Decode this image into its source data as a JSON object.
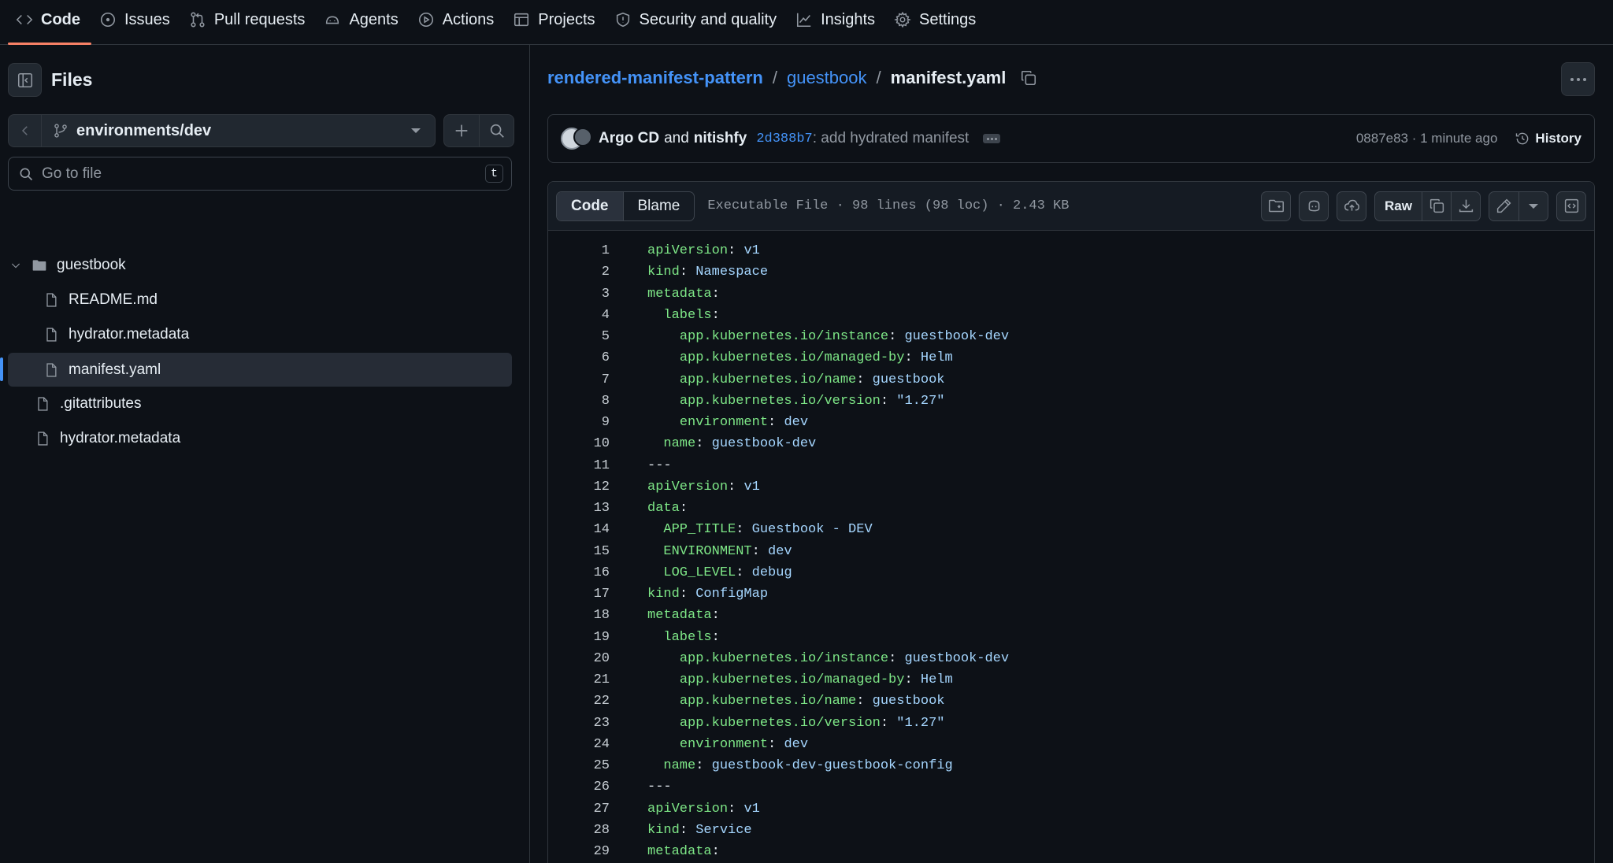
{
  "nav": {
    "tabs": [
      {
        "label": "Code",
        "icon": "code-icon"
      },
      {
        "label": "Issues",
        "icon": "issue-icon"
      },
      {
        "label": "Pull requests",
        "icon": "pull-request-icon"
      },
      {
        "label": "Agents",
        "icon": "agent-icon"
      },
      {
        "label": "Actions",
        "icon": "play-icon"
      },
      {
        "label": "Projects",
        "icon": "table-icon"
      },
      {
        "label": "Security and quality",
        "icon": "shield-icon"
      },
      {
        "label": "Insights",
        "icon": "graph-icon"
      },
      {
        "label": "Settings",
        "icon": "gear-icon"
      }
    ],
    "active": "Code"
  },
  "sidebar": {
    "title": "Files",
    "branch": "environments/dev",
    "search_placeholder": "Go to file",
    "search_shortcut": "t",
    "tree": [
      {
        "name": "guestbook",
        "type": "folder",
        "expanded": true
      },
      {
        "name": "README.md",
        "type": "file"
      },
      {
        "name": "hydrator.metadata",
        "type": "file"
      },
      {
        "name": "manifest.yaml",
        "type": "file",
        "selected": true
      },
      {
        "name": ".gitattributes",
        "type": "file"
      },
      {
        "name": "hydrator.metadata",
        "type": "file"
      }
    ]
  },
  "breadcrumb": {
    "repo": "rendered-manifest-pattern",
    "dir": "guestbook",
    "file": "manifest.yaml",
    "sep": "/"
  },
  "commit": {
    "author1": "Argo CD",
    "and": "and",
    "author2": "nitishfy",
    "sha": "2d388b7",
    "message": ": add hydrated manifest",
    "latest": "0887e83 · 1 minute ago",
    "history_label": "History"
  },
  "file": {
    "view_code": "Code",
    "view_blame": "Blame",
    "info": "Executable File · 98 lines (98 loc) · 2.43 KB",
    "raw_label": "Raw"
  },
  "code_lines": [
    "1",
    "2",
    "3",
    "4",
    "5",
    "6",
    "7",
    "8",
    "9",
    "10",
    "11",
    "12",
    "13",
    "14",
    "15",
    "16",
    "17",
    "18",
    "19",
    "20",
    "21",
    "22",
    "23",
    "24",
    "25",
    "26",
    "27",
    "28",
    "29"
  ],
  "code": [
    {
      "i": 0,
      "k": "apiVersion",
      "v": "v1"
    },
    {
      "i": 0,
      "k": "kind",
      "v": "Namespace"
    },
    {
      "i": 0,
      "k": "metadata",
      "v": ""
    },
    {
      "i": 1,
      "k": "labels",
      "v": ""
    },
    {
      "i": 2,
      "k": "app.kubernetes.io/instance",
      "v": "guestbook-dev"
    },
    {
      "i": 2,
      "k": "app.kubernetes.io/managed-by",
      "v": "Helm"
    },
    {
      "i": 2,
      "k": "app.kubernetes.io/name",
      "v": "guestbook"
    },
    {
      "i": 2,
      "k": "app.kubernetes.io/version",
      "v": "\"1.27\""
    },
    {
      "i": 2,
      "k": "environment",
      "v": "dev"
    },
    {
      "i": 1,
      "k": "name",
      "v": "guestbook-dev"
    },
    {
      "i": 0,
      "raw": "---"
    },
    {
      "i": 0,
      "k": "apiVersion",
      "v": "v1"
    },
    {
      "i": 0,
      "k": "data",
      "v": ""
    },
    {
      "i": 1,
      "k": "APP_TITLE",
      "v": "Guestbook - DEV"
    },
    {
      "i": 1,
      "k": "ENVIRONMENT",
      "v": "dev"
    },
    {
      "i": 1,
      "k": "LOG_LEVEL",
      "v": "debug"
    },
    {
      "i": 0,
      "k": "kind",
      "v": "ConfigMap"
    },
    {
      "i": 0,
      "k": "metadata",
      "v": ""
    },
    {
      "i": 1,
      "k": "labels",
      "v": ""
    },
    {
      "i": 2,
      "k": "app.kubernetes.io/instance",
      "v": "guestbook-dev"
    },
    {
      "i": 2,
      "k": "app.kubernetes.io/managed-by",
      "v": "Helm"
    },
    {
      "i": 2,
      "k": "app.kubernetes.io/name",
      "v": "guestbook"
    },
    {
      "i": 2,
      "k": "app.kubernetes.io/version",
      "v": "\"1.27\""
    },
    {
      "i": 2,
      "k": "environment",
      "v": "dev"
    },
    {
      "i": 1,
      "k": "name",
      "v": "guestbook-dev-guestbook-config"
    },
    {
      "i": 0,
      "raw": "---"
    },
    {
      "i": 0,
      "k": "apiVersion",
      "v": "v1"
    },
    {
      "i": 0,
      "k": "kind",
      "v": "Service"
    },
    {
      "i": 0,
      "k": "metadata",
      "v": ""
    }
  ],
  "colors": {
    "accent": "#4493f8",
    "yaml_key": "#7ee787",
    "yaml_value": "#a5d6ff",
    "active_tab": "#f78166"
  }
}
